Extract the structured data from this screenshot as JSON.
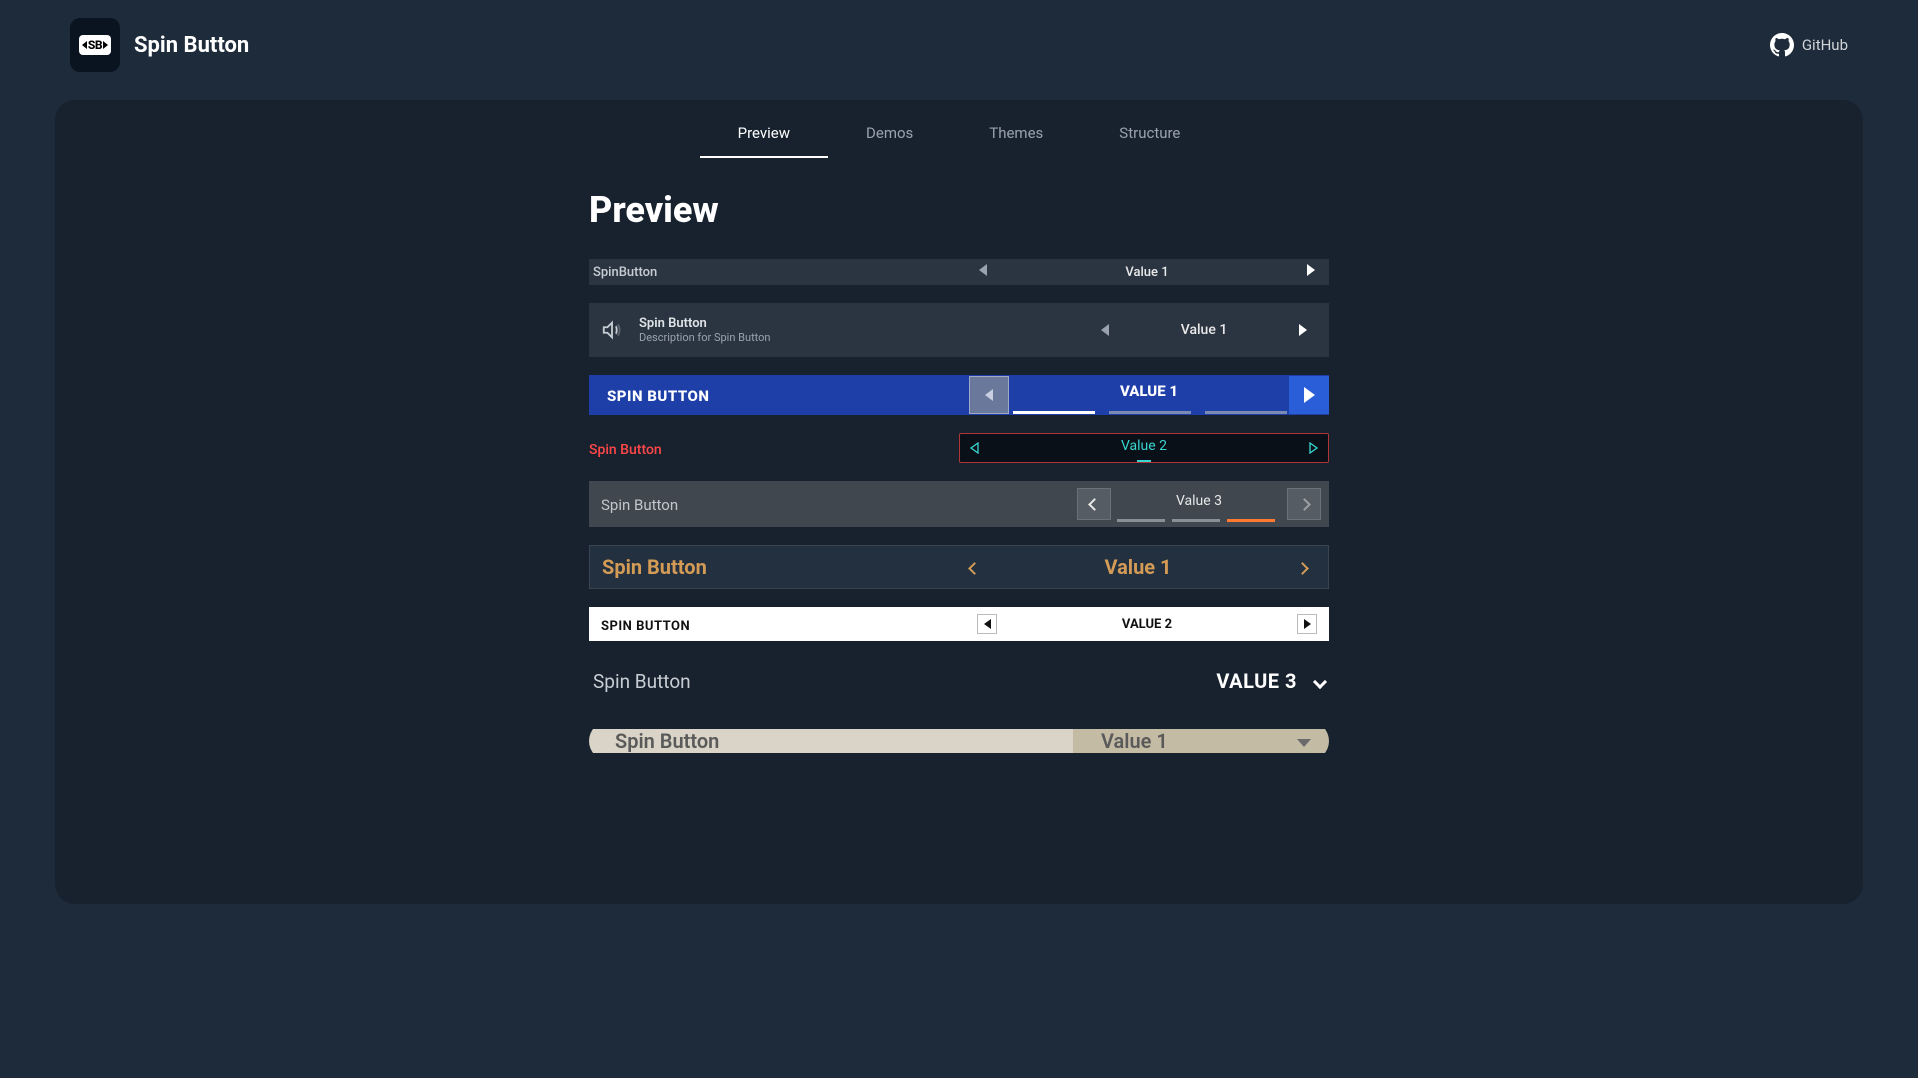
{
  "brand": {
    "name": "Spin Button",
    "logo_text": "SB"
  },
  "header_links": {
    "github": "GitHub"
  },
  "tabs": [
    {
      "label": "Preview",
      "active": true
    },
    {
      "label": "Demos",
      "active": false
    },
    {
      "label": "Themes",
      "active": false
    },
    {
      "label": "Structure",
      "active": false
    }
  ],
  "page_title": "Preview",
  "rows": {
    "r1": {
      "label": "SpinButton",
      "value": "Value 1"
    },
    "r2": {
      "label": "Spin Button",
      "description": "Description for Spin Button",
      "value": "Value 1"
    },
    "r3": {
      "label": "SPIN BUTTON",
      "value": "VALUE 1"
    },
    "r4": {
      "label": "Spin Button",
      "value": "Value 2"
    },
    "r5": {
      "label": "Spin Button",
      "value": "Value 3"
    },
    "r6": {
      "label": "Spin Button",
      "value": "Value 1"
    },
    "r7": {
      "label": "SPIN BUTTON",
      "value": "VALUE 2"
    },
    "r8": {
      "label": "Spin Button",
      "value": "VALUE 3"
    },
    "r9": {
      "label": "Spin Button",
      "value": "Value 1"
    }
  }
}
